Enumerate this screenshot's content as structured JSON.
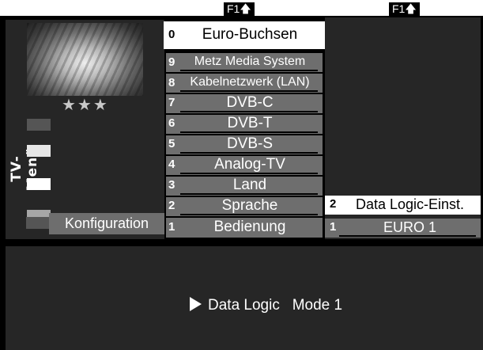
{
  "f1": {
    "left": "F1",
    "right": "F1",
    "arrow": "🡅"
  },
  "side_title": "TV-Menü",
  "rating_stars": "★★★",
  "config_label": "Konfiguration",
  "menu_items": [
    {
      "num": "0",
      "label": "Euro-Buchsen",
      "selected": true
    },
    {
      "num": "9",
      "label": "Metz Media System"
    },
    {
      "num": "8",
      "label": "Kabelnetzwerk (LAN)"
    },
    {
      "num": "7",
      "label": "DVB-C"
    },
    {
      "num": "6",
      "label": "DVB-T"
    },
    {
      "num": "5",
      "label": "DVB-S"
    },
    {
      "num": "4",
      "label": "Analog-TV"
    },
    {
      "num": "3",
      "label": "Land"
    },
    {
      "num": "2",
      "label": "Sprache"
    },
    {
      "num": "1",
      "label": "Bedienung"
    }
  ],
  "submenu_items": [
    {
      "num": "2",
      "label": "Data Logic-Einst."
    },
    {
      "num": "1",
      "label": "EURO 1"
    }
  ],
  "status": {
    "text": "Data Logic",
    "value": "Mode 1"
  }
}
